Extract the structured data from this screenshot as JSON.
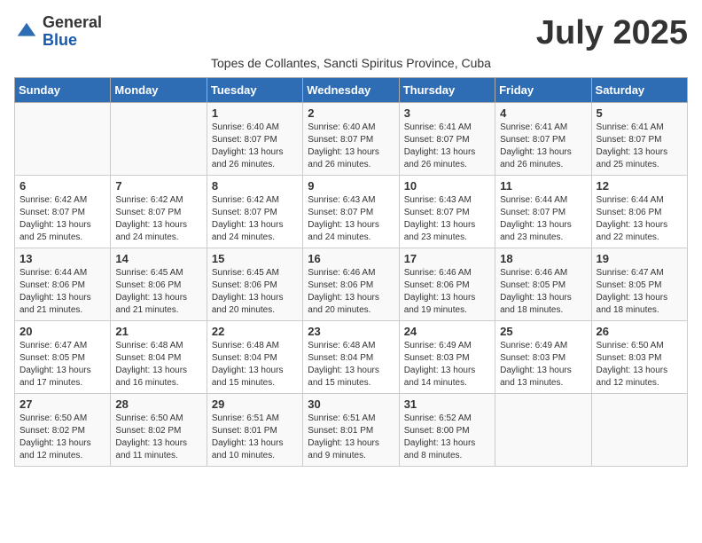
{
  "logo": {
    "general": "General",
    "blue": "Blue"
  },
  "title": "July 2025",
  "subtitle": "Topes de Collantes, Sancti Spiritus Province, Cuba",
  "days_header": [
    "Sunday",
    "Monday",
    "Tuesday",
    "Wednesday",
    "Thursday",
    "Friday",
    "Saturday"
  ],
  "weeks": [
    [
      {
        "num": "",
        "sunrise": "",
        "sunset": "",
        "daylight": ""
      },
      {
        "num": "",
        "sunrise": "",
        "sunset": "",
        "daylight": ""
      },
      {
        "num": "1",
        "sunrise": "Sunrise: 6:40 AM",
        "sunset": "Sunset: 8:07 PM",
        "daylight": "Daylight: 13 hours and 26 minutes."
      },
      {
        "num": "2",
        "sunrise": "Sunrise: 6:40 AM",
        "sunset": "Sunset: 8:07 PM",
        "daylight": "Daylight: 13 hours and 26 minutes."
      },
      {
        "num": "3",
        "sunrise": "Sunrise: 6:41 AM",
        "sunset": "Sunset: 8:07 PM",
        "daylight": "Daylight: 13 hours and 26 minutes."
      },
      {
        "num": "4",
        "sunrise": "Sunrise: 6:41 AM",
        "sunset": "Sunset: 8:07 PM",
        "daylight": "Daylight: 13 hours and 26 minutes."
      },
      {
        "num": "5",
        "sunrise": "Sunrise: 6:41 AM",
        "sunset": "Sunset: 8:07 PM",
        "daylight": "Daylight: 13 hours and 25 minutes."
      }
    ],
    [
      {
        "num": "6",
        "sunrise": "Sunrise: 6:42 AM",
        "sunset": "Sunset: 8:07 PM",
        "daylight": "Daylight: 13 hours and 25 minutes."
      },
      {
        "num": "7",
        "sunrise": "Sunrise: 6:42 AM",
        "sunset": "Sunset: 8:07 PM",
        "daylight": "Daylight: 13 hours and 24 minutes."
      },
      {
        "num": "8",
        "sunrise": "Sunrise: 6:42 AM",
        "sunset": "Sunset: 8:07 PM",
        "daylight": "Daylight: 13 hours and 24 minutes."
      },
      {
        "num": "9",
        "sunrise": "Sunrise: 6:43 AM",
        "sunset": "Sunset: 8:07 PM",
        "daylight": "Daylight: 13 hours and 24 minutes."
      },
      {
        "num": "10",
        "sunrise": "Sunrise: 6:43 AM",
        "sunset": "Sunset: 8:07 PM",
        "daylight": "Daylight: 13 hours and 23 minutes."
      },
      {
        "num": "11",
        "sunrise": "Sunrise: 6:44 AM",
        "sunset": "Sunset: 8:07 PM",
        "daylight": "Daylight: 13 hours and 23 minutes."
      },
      {
        "num": "12",
        "sunrise": "Sunrise: 6:44 AM",
        "sunset": "Sunset: 8:06 PM",
        "daylight": "Daylight: 13 hours and 22 minutes."
      }
    ],
    [
      {
        "num": "13",
        "sunrise": "Sunrise: 6:44 AM",
        "sunset": "Sunset: 8:06 PM",
        "daylight": "Daylight: 13 hours and 21 minutes."
      },
      {
        "num": "14",
        "sunrise": "Sunrise: 6:45 AM",
        "sunset": "Sunset: 8:06 PM",
        "daylight": "Daylight: 13 hours and 21 minutes."
      },
      {
        "num": "15",
        "sunrise": "Sunrise: 6:45 AM",
        "sunset": "Sunset: 8:06 PM",
        "daylight": "Daylight: 13 hours and 20 minutes."
      },
      {
        "num": "16",
        "sunrise": "Sunrise: 6:46 AM",
        "sunset": "Sunset: 8:06 PM",
        "daylight": "Daylight: 13 hours and 20 minutes."
      },
      {
        "num": "17",
        "sunrise": "Sunrise: 6:46 AM",
        "sunset": "Sunset: 8:06 PM",
        "daylight": "Daylight: 13 hours and 19 minutes."
      },
      {
        "num": "18",
        "sunrise": "Sunrise: 6:46 AM",
        "sunset": "Sunset: 8:05 PM",
        "daylight": "Daylight: 13 hours and 18 minutes."
      },
      {
        "num": "19",
        "sunrise": "Sunrise: 6:47 AM",
        "sunset": "Sunset: 8:05 PM",
        "daylight": "Daylight: 13 hours and 18 minutes."
      }
    ],
    [
      {
        "num": "20",
        "sunrise": "Sunrise: 6:47 AM",
        "sunset": "Sunset: 8:05 PM",
        "daylight": "Daylight: 13 hours and 17 minutes."
      },
      {
        "num": "21",
        "sunrise": "Sunrise: 6:48 AM",
        "sunset": "Sunset: 8:04 PM",
        "daylight": "Daylight: 13 hours and 16 minutes."
      },
      {
        "num": "22",
        "sunrise": "Sunrise: 6:48 AM",
        "sunset": "Sunset: 8:04 PM",
        "daylight": "Daylight: 13 hours and 15 minutes."
      },
      {
        "num": "23",
        "sunrise": "Sunrise: 6:48 AM",
        "sunset": "Sunset: 8:04 PM",
        "daylight": "Daylight: 13 hours and 15 minutes."
      },
      {
        "num": "24",
        "sunrise": "Sunrise: 6:49 AM",
        "sunset": "Sunset: 8:03 PM",
        "daylight": "Daylight: 13 hours and 14 minutes."
      },
      {
        "num": "25",
        "sunrise": "Sunrise: 6:49 AM",
        "sunset": "Sunset: 8:03 PM",
        "daylight": "Daylight: 13 hours and 13 minutes."
      },
      {
        "num": "26",
        "sunrise": "Sunrise: 6:50 AM",
        "sunset": "Sunset: 8:03 PM",
        "daylight": "Daylight: 13 hours and 12 minutes."
      }
    ],
    [
      {
        "num": "27",
        "sunrise": "Sunrise: 6:50 AM",
        "sunset": "Sunset: 8:02 PM",
        "daylight": "Daylight: 13 hours and 12 minutes."
      },
      {
        "num": "28",
        "sunrise": "Sunrise: 6:50 AM",
        "sunset": "Sunset: 8:02 PM",
        "daylight": "Daylight: 13 hours and 11 minutes."
      },
      {
        "num": "29",
        "sunrise": "Sunrise: 6:51 AM",
        "sunset": "Sunset: 8:01 PM",
        "daylight": "Daylight: 13 hours and 10 minutes."
      },
      {
        "num": "30",
        "sunrise": "Sunrise: 6:51 AM",
        "sunset": "Sunset: 8:01 PM",
        "daylight": "Daylight: 13 hours and 9 minutes."
      },
      {
        "num": "31",
        "sunrise": "Sunrise: 6:52 AM",
        "sunset": "Sunset: 8:00 PM",
        "daylight": "Daylight: 13 hours and 8 minutes."
      },
      {
        "num": "",
        "sunrise": "",
        "sunset": "",
        "daylight": ""
      },
      {
        "num": "",
        "sunrise": "",
        "sunset": "",
        "daylight": ""
      }
    ]
  ]
}
